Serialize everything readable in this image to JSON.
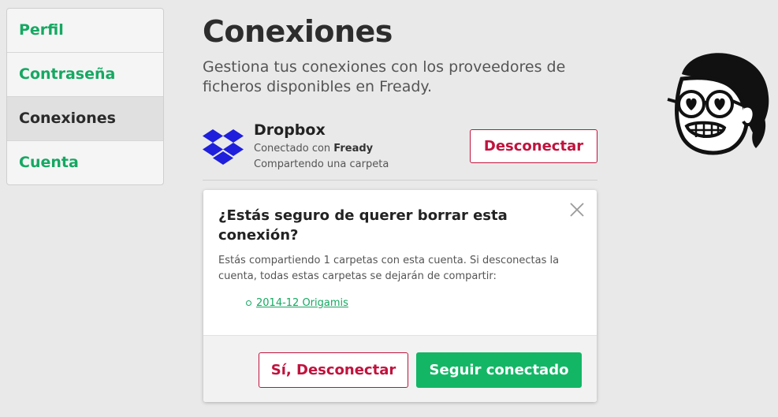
{
  "sidebar": {
    "items": [
      {
        "label": "Perfil",
        "active": false
      },
      {
        "label": "Contraseña",
        "active": false
      },
      {
        "label": "Conexiones",
        "active": true
      },
      {
        "label": "Cuenta",
        "active": false
      }
    ]
  },
  "main": {
    "title": "Conexiones",
    "subtitle": "Gestiona tus conexiones con los proveedores de ficheros disponibles en Fready."
  },
  "connection": {
    "icon": "dropbox-icon",
    "name": "Dropbox",
    "status_prefix": "Conectado con ",
    "status_account": "Fready",
    "sharing": "Compartendo una carpeta",
    "disconnect_label": "Desconectar"
  },
  "modal": {
    "title": "¿Estás seguro de querer borrar esta conexión?",
    "body": "Estás compartiendo 1 carpetas con esta cuenta. Si desconectas la cuenta, todas estas carpetas se dejarán de compartir:",
    "folders": [
      "2014-12 Origamis"
    ],
    "confirm_label": "Sí, Desconectar",
    "cancel_label": "Seguir conectado",
    "close_icon": "close-icon"
  },
  "colors": {
    "accent_green": "#13b665",
    "danger_red": "#c0133d",
    "dropbox_blue": "#1f1fdc"
  }
}
